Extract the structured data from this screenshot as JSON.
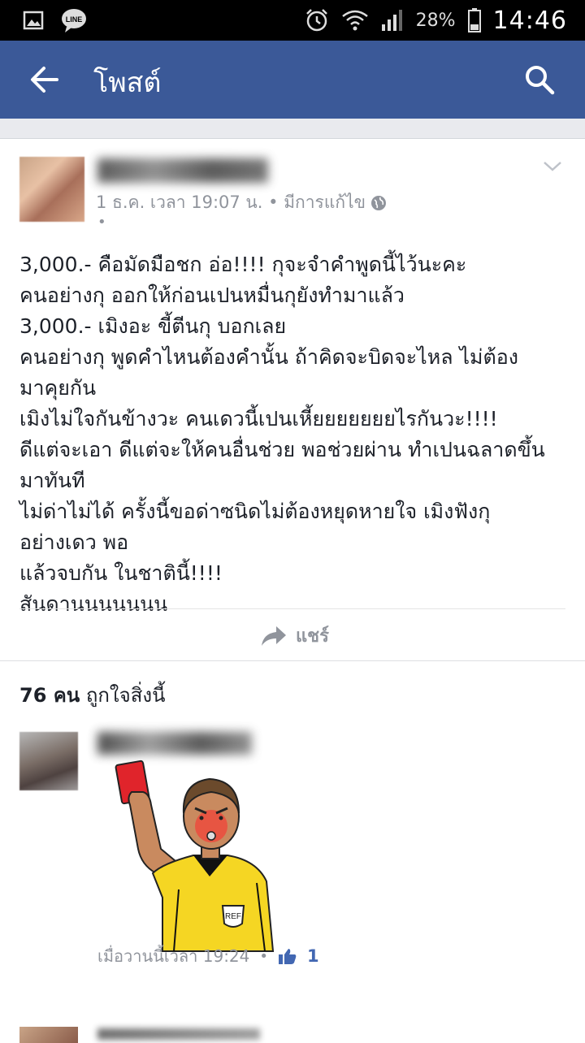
{
  "status_bar": {
    "icons": [
      "gallery-icon",
      "line-app-icon",
      "alarm-icon",
      "wifi-icon",
      "signal-icon",
      "battery-icon"
    ],
    "battery": "28%",
    "time": "14:46"
  },
  "app_bar": {
    "title": "โพสต์",
    "color": "#3b5998"
  },
  "post": {
    "meta": "1 ธ.ค. เวลา 19:07 น. • มีการแก้ไข",
    "meta_dot": "•",
    "body_lines": [
      "3,000.- คือมัดมือชก อ่อ!!!! กุจะจำคำพูดนี้ไว้นะคะ",
      "คนอย่างกุ ออกให้ก่อนเปนหมื่นกุยังทำมาแล้ว",
      "3,000.- เมิงอะ ขี้ตีนกุ บอกเลย",
      "คนอย่างกุ พูดคำไหนต้องคำนั้น ถ้าคิดจะบิดจะไหล ไม่ต้อง",
      "มาคุยกัน",
      "เมิงไม่ใจกันข้างวะ คนเดวนี้เปนเหี้ยยยยยยยไรกันวะ!!!!",
      "ดีแต่จะเอา ดีแต่จะให้คนอื่นช่วย พอช่วยผ่าน ทำเปนฉลาดขึ้น",
      "มาทันที",
      "ไม่ด่าไม่ได้ ครั้งนี้ขอด่าซนิดไม่ต้องหยุดหายใจ เมิงฟังกุ",
      "อย่างเดว พอ",
      "แล้วจบกัน ในชาตินี้!!!!",
      "สันดานนนนนนน"
    ],
    "share_label": "แชร์"
  },
  "likes": {
    "count": "76 คน",
    "text": "ถูกใจสิ่งนี้"
  },
  "comment": {
    "time": "เมื่อวานนี้เวลา 19:24",
    "dot": "•",
    "like_count": "1"
  }
}
